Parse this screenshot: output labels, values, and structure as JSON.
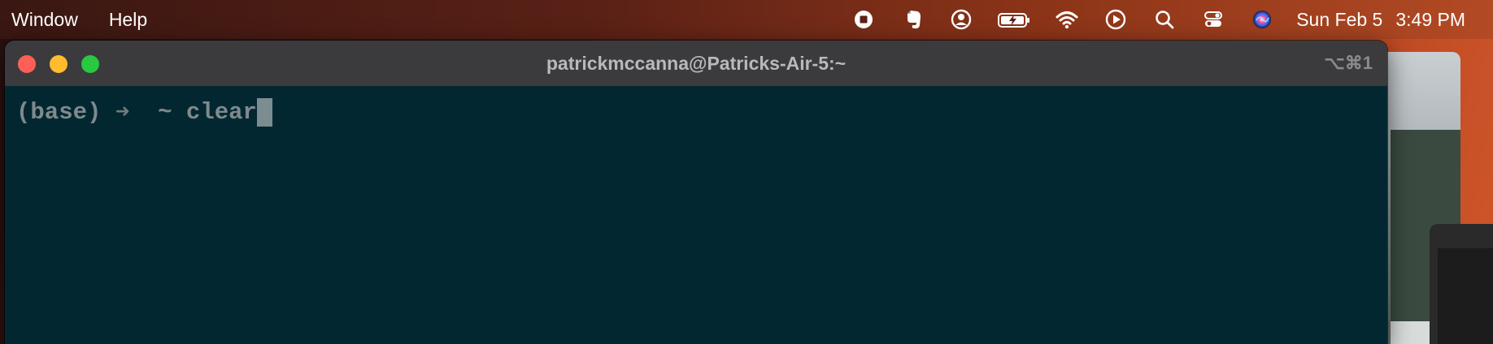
{
  "menubar": {
    "items": [
      "Window",
      "Help"
    ],
    "status_icons": [
      "screen-record-icon",
      "evernote-icon",
      "user-account-icon",
      "battery-charging-icon",
      "wifi-icon",
      "play-icon",
      "search-icon",
      "control-center-icon",
      "siri-icon"
    ],
    "clock_date": "Sun Feb 5",
    "clock_time": "3:49 PM"
  },
  "terminal": {
    "title": "patrickmccanna@Patricks-Air-5:~",
    "shortcut": "⌥⌘1",
    "prompt_env": "(base)",
    "prompt_arrow": "➜",
    "prompt_dir": "~",
    "command": "clear"
  },
  "colors": {
    "terminal_bg": "#032731",
    "titlebar_bg": "#3b3b3d",
    "close": "#fe5f57",
    "minimize": "#febc2e",
    "maximize": "#28c840"
  }
}
